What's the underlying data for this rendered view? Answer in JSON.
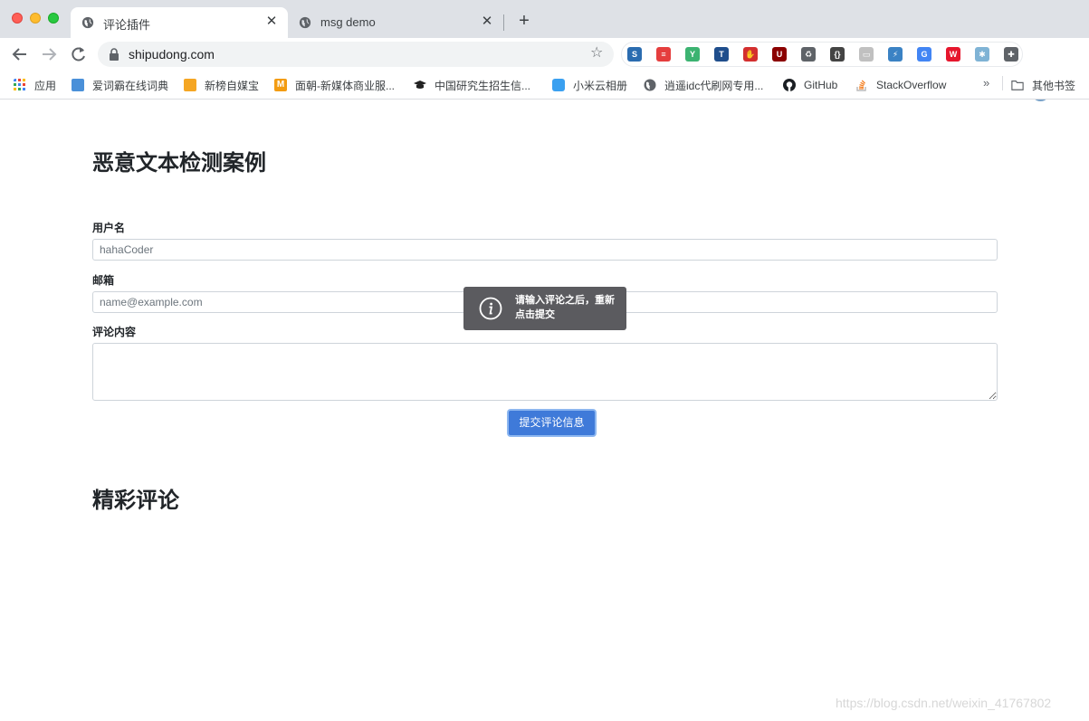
{
  "browser": {
    "tabs": [
      {
        "title": "评论插件",
        "active": true
      },
      {
        "title": "msg demo",
        "active": false
      }
    ],
    "url": "shipudong.com",
    "bookmarks": [
      {
        "label": "应用",
        "icon": "apps-grid-icon"
      },
      {
        "label": "爱词霸在线词典",
        "icon": "iciba-icon"
      },
      {
        "label": "新榜自媒宝",
        "icon": "xinbang-icon"
      },
      {
        "label": "面朝-新媒体商业服...",
        "icon": "mianchao-icon"
      },
      {
        "label": "中国研究生招生信...",
        "icon": "graduation-cap-icon"
      },
      {
        "label": "小米云相册",
        "icon": "cloud-icon"
      },
      {
        "label": "逍遥idc代刷网专用...",
        "icon": "globe-icon"
      },
      {
        "label": "GitHub",
        "icon": "github-icon"
      },
      {
        "label": "StackOverflow",
        "icon": "stackoverflow-icon"
      }
    ],
    "bookmarks_more": "»",
    "other_bookmarks": "其他书签",
    "extensions": [
      {
        "name": "sougou-ext-icon",
        "color": "#2b6cb0",
        "glyph": "S"
      },
      {
        "name": "notes-ext-icon",
        "color": "#e53e3e",
        "glyph": "≡"
      },
      {
        "name": "vue-ext-icon",
        "color": "#3cb371",
        "glyph": "Y"
      },
      {
        "name": "tophub-ext-icon",
        "color": "#1f4e8c",
        "glyph": "T"
      },
      {
        "name": "adblock-ext-icon",
        "color": "#d32f2f",
        "glyph": "✋"
      },
      {
        "name": "ublock-ext-icon",
        "color": "#8b0000",
        "glyph": "U"
      },
      {
        "name": "recycle-ext-icon",
        "color": "#5f6368",
        "glyph": "♻"
      },
      {
        "name": "json-ext-icon",
        "color": "#444444",
        "glyph": "{}"
      },
      {
        "name": "screenshot-ext-icon",
        "color": "#c0c0c0",
        "glyph": "▭"
      },
      {
        "name": "codepen-ext-icon",
        "color": "#3b82c4",
        "glyph": "⚡"
      },
      {
        "name": "translate-ext-icon",
        "color": "#4285f4",
        "glyph": "G"
      },
      {
        "name": "weibo-ext-icon",
        "color": "#e6162d",
        "glyph": "W"
      },
      {
        "name": "snowflake-ext-icon",
        "color": "#7fb3d5",
        "glyph": "✱"
      },
      {
        "name": "puzzle-ext-icon",
        "color": "#5f6368",
        "glyph": "✚"
      }
    ]
  },
  "page": {
    "title": "恶意文本检测案例",
    "username_label": "用户名",
    "username_placeholder": "hahaCoder",
    "email_label": "邮箱",
    "email_placeholder": "name@example.com",
    "comment_label": "评论内容",
    "comment_value": "",
    "submit_label": "提交评论信息",
    "comments_title": "精彩评论"
  },
  "toast": {
    "message": "请输入评论之后，重新点击提交",
    "icon": "info-icon"
  },
  "watermark": "https://blog.csdn.net/weixin_41767802"
}
